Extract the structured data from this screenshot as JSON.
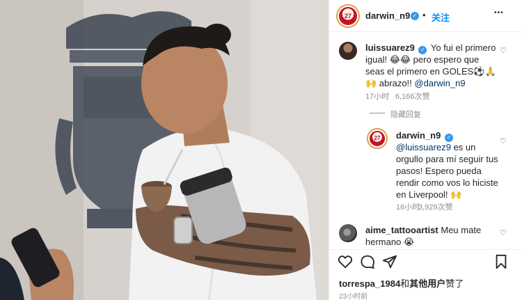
{
  "post": {
    "author": "darwin_n9",
    "separator": "•",
    "follow_label": "关注",
    "more_label": "•••",
    "avatar_number": "27"
  },
  "comments": [
    {
      "username": "luissuarez9",
      "text_line1": "Yo fui el primero",
      "text_line2": "igual! 😂😂 pero espero que",
      "text_line3": "seas el primero en GOLES⚽🙏",
      "text_line4": "🙌 abrazo!!",
      "mention": "@darwin_n9",
      "time": "17小时",
      "likes": "6,166次赞",
      "heart": "♡"
    }
  ],
  "hide_replies_label": "隐藏回复",
  "reply": {
    "username": "darwin_n9",
    "mention": "@luissuarez9",
    "text_line1": "es un",
    "text_line2": "orgullo para mí seguir tus",
    "text_line3": "pasos! Espero pueda",
    "text_line4": "rendir como vos lo hiciste",
    "text_line5": "en Liverpool! 🙌",
    "time": "16小时",
    "likes": "3,929次赞",
    "heart": "♡"
  },
  "comment3": {
    "username": "aime_tattooartist",
    "text_line1": "Meu mate",
    "text_line2": "hermano 😭",
    "heart": "♡"
  },
  "footer": {
    "liked_by_user": "torrespa_1984",
    "liked_by_conj": "和",
    "liked_by_others": "其他用户",
    "liked_by_suffix": "赞了",
    "time": "23小时前"
  },
  "icons": {
    "heart": "heart-icon",
    "comment": "comment-icon",
    "share": "share-icon",
    "save": "bookmark-icon",
    "verified": "verified-badge-icon"
  },
  "colors": {
    "follow": "#0095f6",
    "verified": "#3897f0",
    "liverpool_red": "#c8102e"
  }
}
